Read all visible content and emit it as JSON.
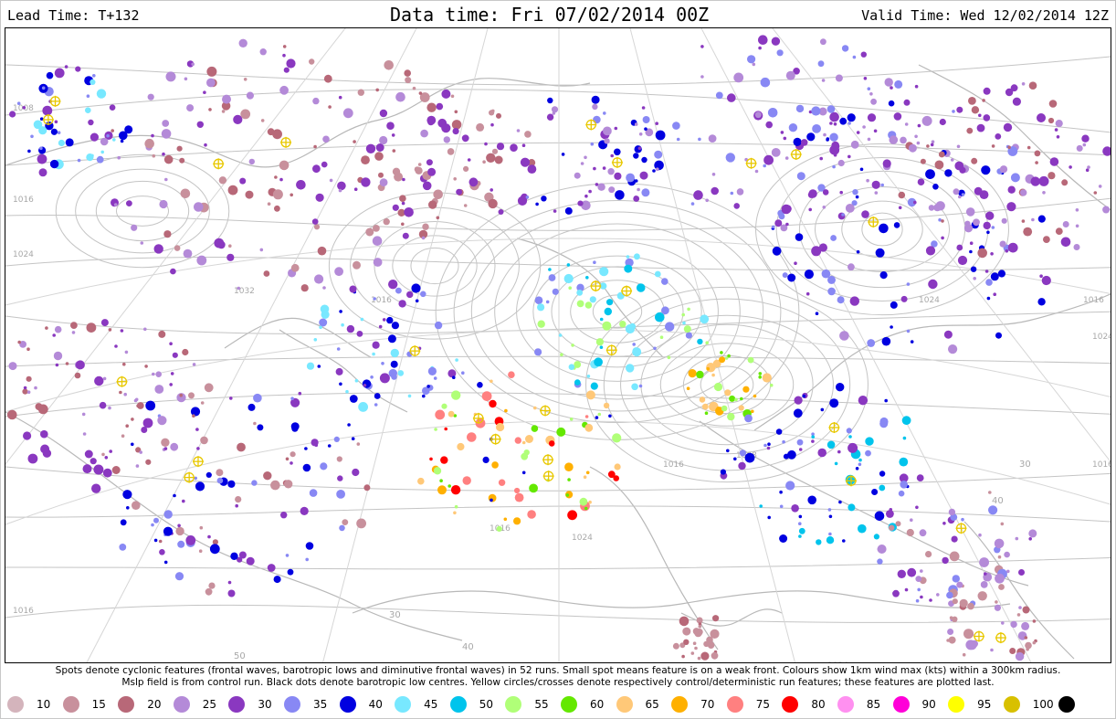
{
  "header": {
    "lead_time": "Lead Time: T+132",
    "data_time": "Data time:  Fri 07/02/2014 00Z",
    "valid_time": "Valid Time: Wed 12/02/2014 12Z"
  },
  "caption": {
    "line1": "Spots denote cyclonic features (frontal waves, barotropic lows and diminutive frontal waves) in 52 runs. Small spot means feature is on a weak front. Colours show 1km wind max (kts) within a 300km radius.",
    "line2": "Mslp field is from control run. Black dots denote barotropic low centres. Yellow circles/crosses denote respectively control/deterministic run features; these features are plotted last."
  },
  "legend": [
    {
      "label": "10",
      "color": "#d4b4bc"
    },
    {
      "label": "15",
      "color": "#c8909c"
    },
    {
      "label": "20",
      "color": "#b86878"
    },
    {
      "label": "25",
      "color": "#b48ad8"
    },
    {
      "label": "30",
      "color": "#8a38c0"
    },
    {
      "label": "35",
      "color": "#8888f4"
    },
    {
      "label": "40",
      "color": "#0000e0"
    },
    {
      "label": "45",
      "color": "#78e8ff"
    },
    {
      "label": "50",
      "color": "#00c4ec"
    },
    {
      "label": "55",
      "color": "#b0ff78"
    },
    {
      "label": "60",
      "color": "#64e800"
    },
    {
      "label": "65",
      "color": "#ffc878"
    },
    {
      "label": "70",
      "color": "#ffb000"
    },
    {
      "label": "75",
      "color": "#ff8080"
    },
    {
      "label": "80",
      "color": "#ff0000"
    },
    {
      "label": "85",
      "color": "#ff90f0"
    },
    {
      "label": "90",
      "color": "#ff00d8"
    },
    {
      "label": "95",
      "color": "#ffff00"
    },
    {
      "label": "100",
      "color": "#d8c000"
    },
    {
      "label": "",
      "color": "#000000"
    }
  ],
  "isobar_labels": [
    "1008",
    "1016",
    "1024",
    "1032",
    "1016",
    "1024",
    "1008",
    "1016",
    "1024",
    "1016",
    "1016",
    "1024",
    "1016",
    "1016",
    "1024"
  ],
  "lat_labels": [
    "30",
    "40",
    "50",
    "30",
    "40"
  ]
}
